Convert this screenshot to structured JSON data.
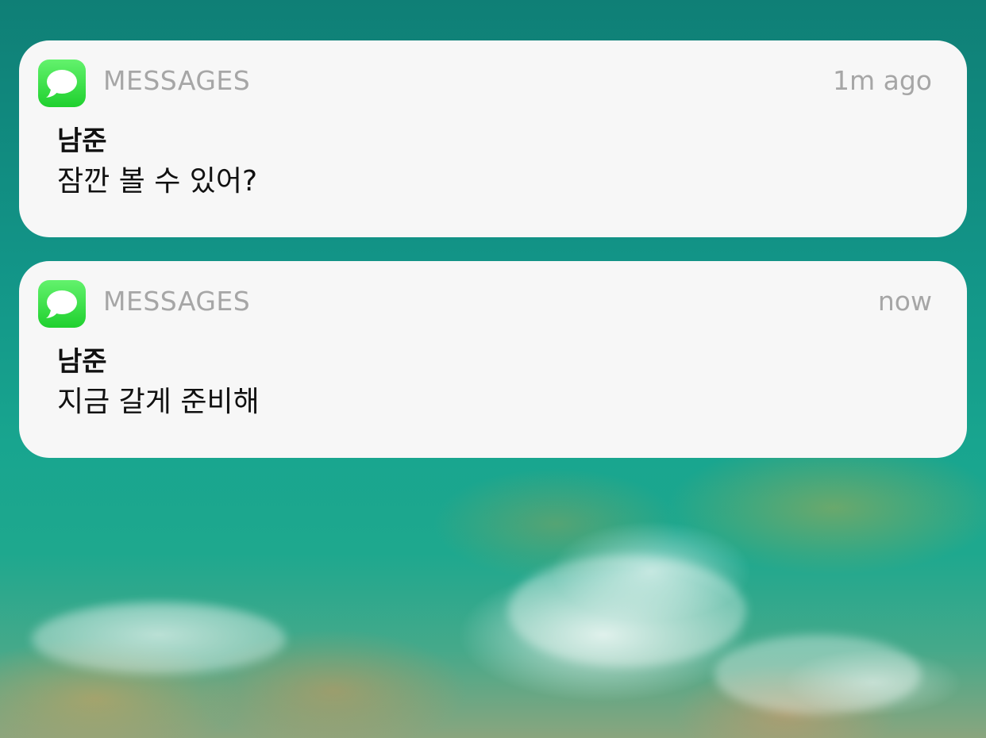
{
  "notifications": [
    {
      "app_name": "MESSAGES",
      "icon": "messages-app-icon",
      "time": "1m ago",
      "sender": "남준",
      "message": "잠깐 볼 수 있어?"
    },
    {
      "app_name": "MESSAGES",
      "icon": "messages-app-icon",
      "time": "now",
      "sender": "남준",
      "message": "지금 갈게 준비해"
    }
  ],
  "colors": {
    "card_background": "#f7f7f7",
    "secondary_text": "#a6a6a6",
    "primary_text": "#111111",
    "messages_icon_green": "#1fd02e"
  }
}
